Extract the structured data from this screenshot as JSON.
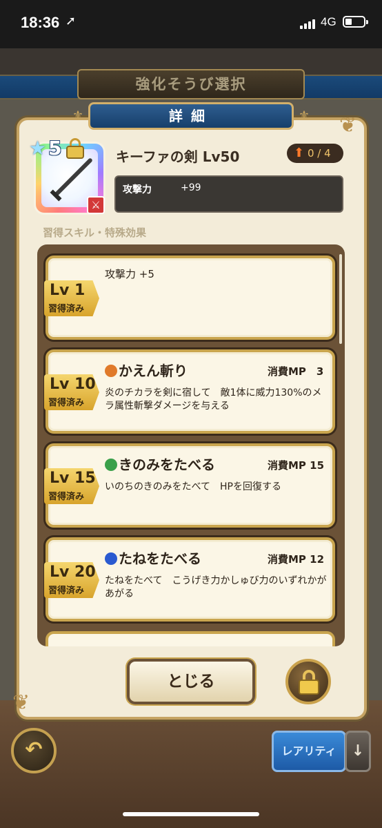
{
  "status_bar": {
    "time": "18:36",
    "network": "4G"
  },
  "screen_title": "強化そうび選択",
  "dialog": {
    "title": "詳細",
    "item": {
      "rarity_stars": "5",
      "name": "キーファの剣 Lv50",
      "upgrade_count": "0 / 4",
      "stat_name": "攻撃力",
      "stat_value": "+99"
    },
    "section_label": "習得スキル・特殊効果",
    "skills": [
      {
        "level": "Lv 1",
        "learned": "習得済み",
        "title": "攻撃力 +5",
        "mp": "",
        "description": ""
      },
      {
        "level": "Lv 10",
        "learned": "習得済み",
        "title": "かえん斬り",
        "mp": "消費MP　3",
        "description": "炎のチカラを剣に宿して　敵1体に威力130%のメラ属性斬撃ダメージを与える",
        "icon_color": "#e07a2a"
      },
      {
        "level": "Lv 15",
        "learned": "習得済み",
        "title": "きのみをたべる",
        "mp": "消費MP 15",
        "description": "いのちのきのみをたべて　HPを回復する",
        "icon_color": "#3aa04a"
      },
      {
        "level": "Lv 20",
        "learned": "習得済み",
        "title": "たねをたべる",
        "mp": "消費MP 12",
        "description": "たねをたべて　こうげき力かしゅび力のいずれかがあがる",
        "icon_color": "#2a5ad0"
      }
    ],
    "close_label": "とじる"
  },
  "bottom_bar": {
    "rarity_label": "レアリティ",
    "back_icon": "back-arrow-icon",
    "sort_icon": "down-arrow-icon"
  }
}
